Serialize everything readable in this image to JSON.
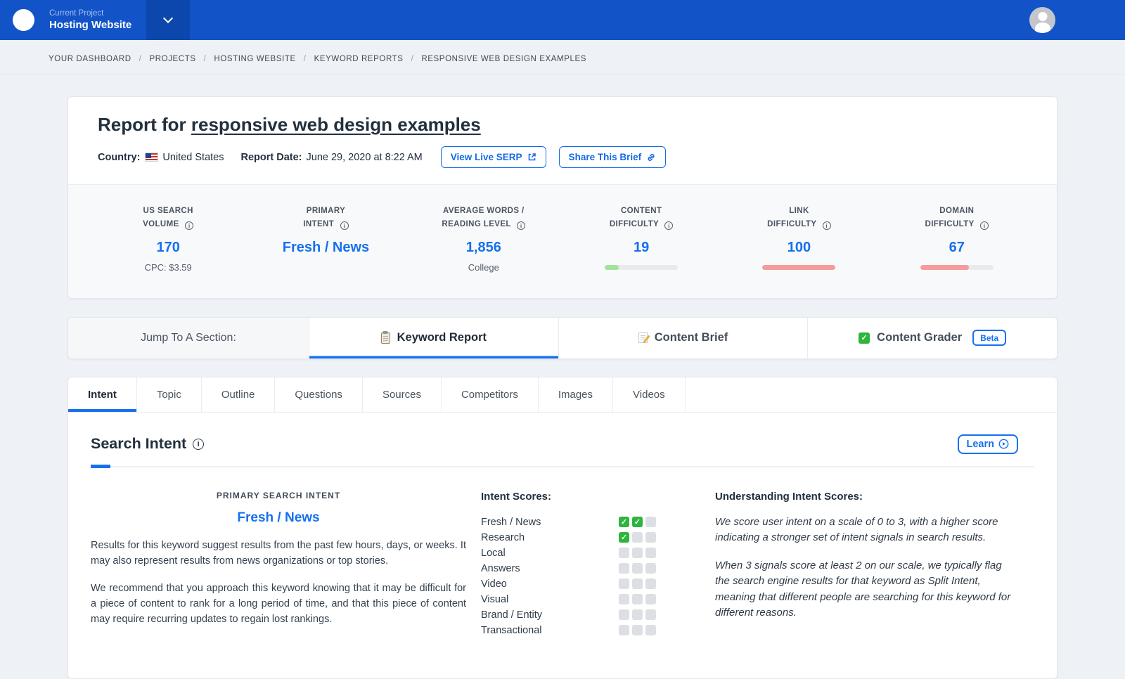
{
  "colors": {
    "header_blue": "#1254c8",
    "accent_blue": "#1670f0",
    "difficulty_green": "#a2e39b",
    "difficulty_red": "#f59b9b",
    "check_green": "#2db53c"
  },
  "topbar": {
    "project_label": "Current Project",
    "project_name": "Hosting Website"
  },
  "breadcrumb": [
    "YOUR DASHBOARD",
    "PROJECTS",
    "HOSTING WEBSITE",
    "KEYWORD REPORTS",
    "RESPONSIVE WEB DESIGN EXAMPLES"
  ],
  "report": {
    "title_prefix": "Report for ",
    "title_keyword": "responsive web design examples",
    "country_label": "Country:",
    "country_value": "United States",
    "date_label": "Report Date:",
    "date_value": "June 29, 2020 at 8:22 AM",
    "view_serp_button": "View Live SERP",
    "share_button": "Share This Brief"
  },
  "stats": [
    {
      "label_line1": "US SEARCH",
      "label_line2": "VOLUME",
      "value": "170",
      "sub": "CPC: $3.59"
    },
    {
      "label_line1": "PRIMARY",
      "label_line2": "INTENT",
      "value": "Fresh / News"
    },
    {
      "label_line1": "AVERAGE WORDS /",
      "label_line2": "READING LEVEL",
      "value": "1,856",
      "sub": "College"
    },
    {
      "label_line1": "CONTENT",
      "label_line2": "DIFFICULTY",
      "value": "19",
      "bar_percent": 19,
      "bar_color": "#a2e39b"
    },
    {
      "label_line1": "LINK",
      "label_line2": "DIFFICULTY",
      "value": "100",
      "bar_percent": 100,
      "bar_color": "#f59b9b"
    },
    {
      "label_line1": "DOMAIN",
      "label_line2": "DIFFICULTY",
      "value": "67",
      "bar_percent": 67,
      "bar_color": "#f59b9b"
    }
  ],
  "jump_nav": {
    "label": "Jump To A Section:",
    "items": [
      {
        "label": "Keyword Report",
        "icon": "clipboard-icon",
        "active": true
      },
      {
        "label": "Content Brief",
        "icon": "memo-pencil-icon",
        "active": false
      },
      {
        "label": "Content Grader",
        "icon": "check-square-icon",
        "active": false,
        "badge": "Beta"
      }
    ]
  },
  "tabs": [
    {
      "label": "Intent",
      "active": true
    },
    {
      "label": "Topic",
      "active": false
    },
    {
      "label": "Outline",
      "active": false
    },
    {
      "label": "Questions",
      "active": false
    },
    {
      "label": "Sources",
      "active": false
    },
    {
      "label": "Competitors",
      "active": false
    },
    {
      "label": "Images",
      "active": false
    },
    {
      "label": "Videos",
      "active": false
    }
  ],
  "intent": {
    "heading": "Search Intent",
    "learn_button": "Learn",
    "primary_label": "PRIMARY SEARCH INTENT",
    "primary_value": "Fresh / News",
    "paragraphs": [
      "Results for this keyword suggest results from the past few hours, days, or weeks. It may also represent results from news organizations or top stories.",
      "We recommend that you approach this keyword knowing that it may be difficult for a piece of content to rank for a long period of time, and that this piece of content may require recurring updates to regain lost rankings."
    ],
    "scores_heading": "Intent Scores:",
    "scores_max": 3,
    "scores": [
      {
        "label": "Fresh / News",
        "score": 2
      },
      {
        "label": "Research",
        "score": 1
      },
      {
        "label": "Local",
        "score": 0
      },
      {
        "label": "Answers",
        "score": 0
      },
      {
        "label": "Video",
        "score": 0
      },
      {
        "label": "Visual",
        "score": 0
      },
      {
        "label": "Brand / Entity",
        "score": 0
      },
      {
        "label": "Transactional",
        "score": 0
      }
    ],
    "understanding_heading": "Understanding Intent Scores:",
    "understanding_paragraphs": [
      "We score user intent on a scale of 0 to 3, with a higher score indicating a stronger set of intent signals in search results.",
      "When 3 signals score at least 2 on our scale, we typically flag the search engine results for that keyword as Split Intent, meaning that different people are searching for this keyword for different reasons."
    ]
  }
}
